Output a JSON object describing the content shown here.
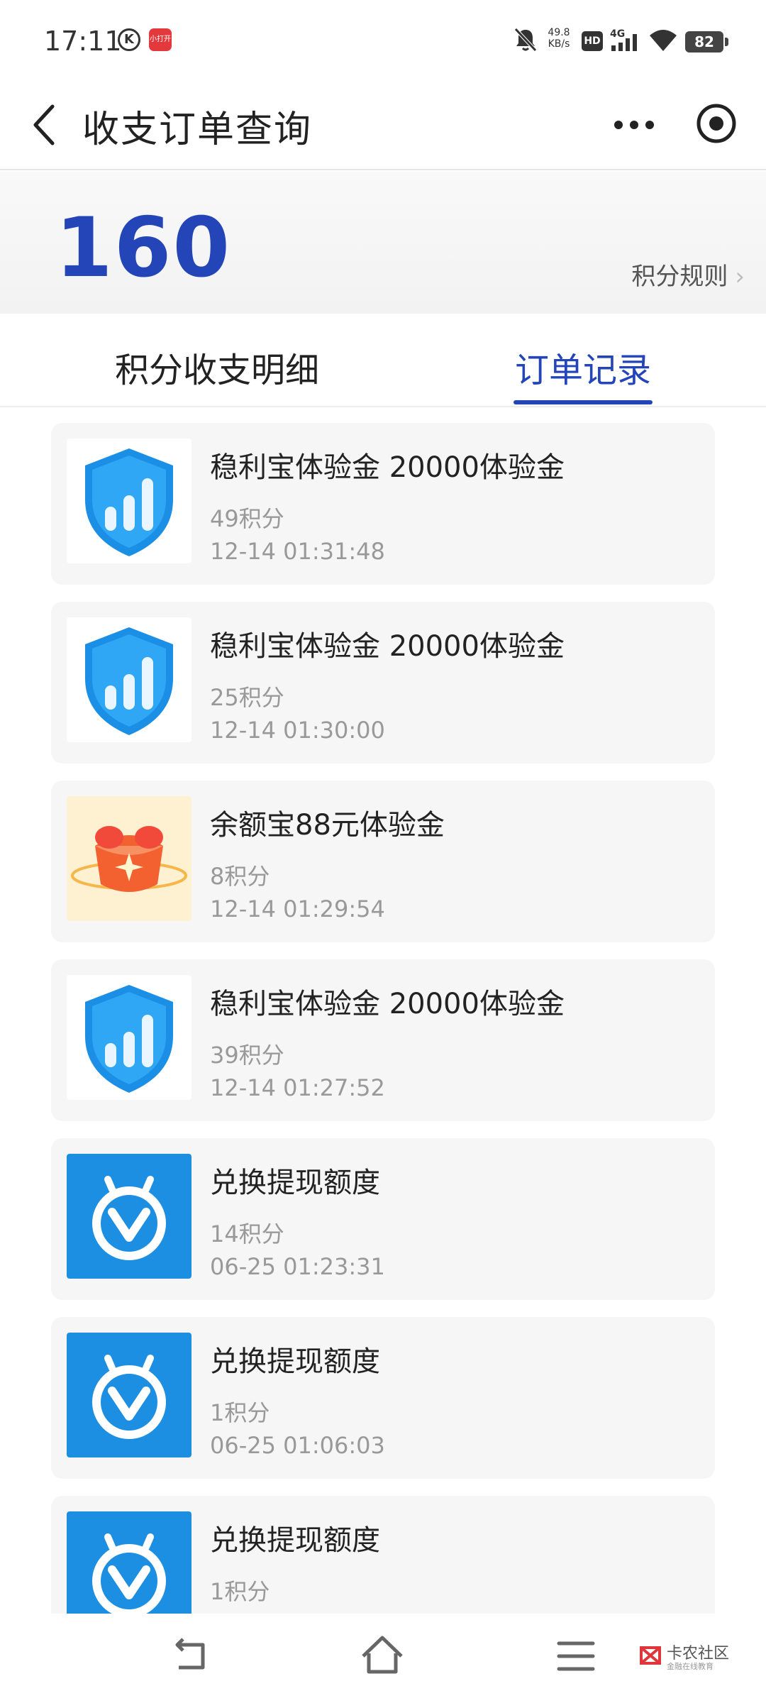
{
  "status_bar": {
    "time": "17:11",
    "k_badge": "K",
    "app_badge": "小打开",
    "net_speed_value": "49.8",
    "net_speed_unit": "KB/s",
    "hd": "HD",
    "signal": "4G",
    "battery": "82"
  },
  "title_bar": {
    "title": "收支订单查询",
    "icons": [
      "back-icon",
      "more-icon",
      "capsule-icon"
    ]
  },
  "points": {
    "value": "160",
    "rules_label": "积分规则",
    "rules_chevron": "›"
  },
  "tabs": [
    {
      "label": "积分收支明细",
      "active": false
    },
    {
      "label": "订单记录",
      "active": true
    }
  ],
  "orders": [
    {
      "name": "稳利宝体验金 20000体验金",
      "points": "49积分",
      "time": "12-14 01:31:48",
      "icon": "shield-chart-icon"
    },
    {
      "name": "稳利宝体验金 20000体验金",
      "points": "25积分",
      "time": "12-14 01:30:00",
      "icon": "shield-chart-icon"
    },
    {
      "name": "余额宝88元体验金",
      "points": "8积分",
      "time": "12-14 01:29:54",
      "icon": "gold-bowl-icon"
    },
    {
      "name": "稳利宝体验金 20000体验金",
      "points": "39积分",
      "time": "12-14 01:27:52",
      "icon": "shield-chart-icon"
    },
    {
      "name": "兑换提现额度",
      "points": "14积分",
      "time": "06-25 01:23:31",
      "icon": "withdraw-v-icon"
    },
    {
      "name": "兑换提现额度",
      "points": "1积分",
      "time": "06-25 01:06:03",
      "icon": "withdraw-v-icon"
    },
    {
      "name": "兑换提现额度",
      "points": "1积分",
      "time": "",
      "icon": "withdraw-v-icon"
    }
  ],
  "watermark": {
    "title": "卡农社区",
    "subtitle": "金融在线教育"
  },
  "colors": {
    "accent": "#2345b8",
    "card_bg": "#f6f6f6",
    "muted_text": "#999999"
  }
}
